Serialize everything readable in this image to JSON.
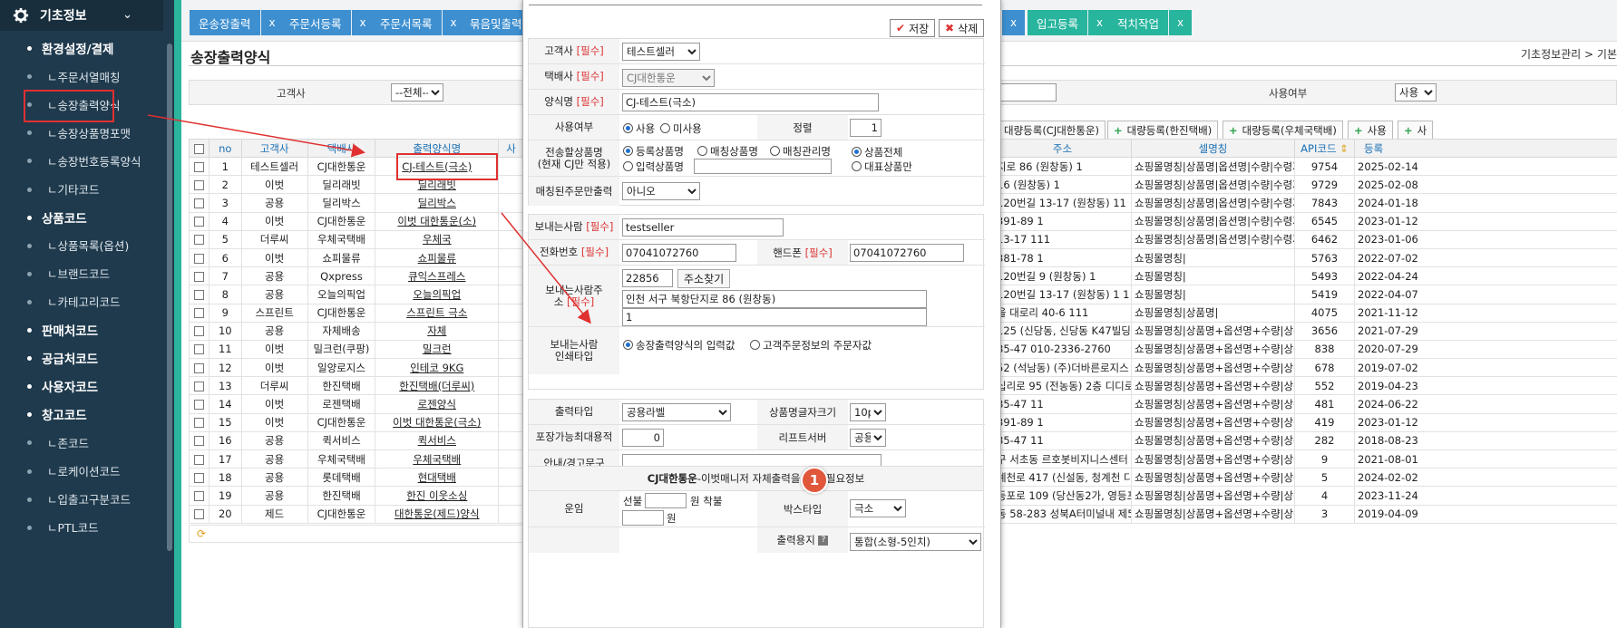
{
  "sidebar": {
    "header": "기초정보",
    "items": [
      {
        "label": "환경설정/결제",
        "kind": "cat"
      },
      {
        "label": "ㄴ주문서열매칭",
        "kind": "sub"
      },
      {
        "label": "ㄴ송장출력양식",
        "kind": "sub"
      },
      {
        "label": "ㄴ송장상품명포맷",
        "kind": "sub"
      },
      {
        "label": "ㄴ송장번호등록양식",
        "kind": "sub"
      },
      {
        "label": "ㄴ기타코드",
        "kind": "sub"
      },
      {
        "label": "상품코드",
        "kind": "cat"
      },
      {
        "label": "ㄴ상품목록(옵션)",
        "kind": "sub"
      },
      {
        "label": "ㄴ브랜드코드",
        "kind": "sub"
      },
      {
        "label": "ㄴ카테고리코드",
        "kind": "sub"
      },
      {
        "label": "판매처코드",
        "kind": "cat"
      },
      {
        "label": "공급처코드",
        "kind": "cat"
      },
      {
        "label": "사용자코드",
        "kind": "cat"
      },
      {
        "label": "창고코드",
        "kind": "cat"
      },
      {
        "label": "ㄴ존코드",
        "kind": "sub"
      },
      {
        "label": "ㄴ로케이션코드",
        "kind": "sub"
      },
      {
        "label": "ㄴ입출고구분코드",
        "kind": "sub"
      },
      {
        "label": "ㄴPTL코드",
        "kind": "sub"
      }
    ]
  },
  "tabs": {
    "t1": "운송장출력",
    "t2": "주문서등록",
    "t3": "주문서목록",
    "t4": "묶음및출력",
    "t5": "입고등록",
    "t6": "적치작업",
    "close": "x"
  },
  "page": {
    "title": "송장출력양식",
    "breadcrumb": "기초정보관리 > 기본",
    "filter": {
      "customer_label": "고객사",
      "customer_value": "--전체--",
      "use_label": "사용여부",
      "use_value": "사용"
    }
  },
  "actions": {
    "b1": "대량등록(CJ대한통운)",
    "b2": "대량등록(한진택배)",
    "b3": "대량등록(우체국택배)",
    "b4": "사용",
    "b5": "사"
  },
  "left_table": {
    "headers": [
      "no",
      "고객사",
      "택배사",
      "출력양식명",
      "사"
    ],
    "rows": [
      [
        "1",
        "테스트셀러",
        "CJ대한통운",
        "CJ-테스트(극소)"
      ],
      [
        "2",
        "이벗",
        "딜리래빗",
        "딜리래빗"
      ],
      [
        "3",
        "공용",
        "딜리박스",
        "딜리박스"
      ],
      [
        "4",
        "이벗",
        "CJ대한통운",
        "이벗 대한통운(소)"
      ],
      [
        "5",
        "더루씨",
        "우체국택배",
        "우체국"
      ],
      [
        "6",
        "이벗",
        "쇼피물류",
        "쇼피물류"
      ],
      [
        "7",
        "공용",
        "Qxpress",
        "큐익스프레스"
      ],
      [
        "8",
        "공용",
        "오늘의픽업",
        "오늘의픽업"
      ],
      [
        "9",
        "스프린트",
        "CJ대한통운",
        "스프린트 극소"
      ],
      [
        "10",
        "공용",
        "자체배송",
        "자체"
      ],
      [
        "11",
        "이벗",
        "밀크런(쿠팡)",
        "밀크런"
      ],
      [
        "12",
        "이벗",
        "일양로지스",
        "인테코 9KG"
      ],
      [
        "13",
        "더루씨",
        "한진택배",
        "한진택배(더루씨)"
      ],
      [
        "14",
        "이벗",
        "로젠택배",
        "로젠양식"
      ],
      [
        "15",
        "이벗",
        "CJ대한통운",
        "이벗 대한통운(극소)"
      ],
      [
        "16",
        "공용",
        "퀵서비스",
        "퀵서비스"
      ],
      [
        "17",
        "공용",
        "우체국택배",
        "우체국택배"
      ],
      [
        "18",
        "공용",
        "롯데택배",
        "현대택배"
      ],
      [
        "19",
        "공용",
        "한진택배",
        "한진 이웃소싱"
      ],
      [
        "20",
        "제드",
        "CJ대한통운",
        "대한통운(제드)양식"
      ]
    ]
  },
  "right_table": {
    "headers": [
      "주소",
      "셀명칭",
      "API코드",
      "등록"
    ],
    "rows": [
      [
        "지로 86 (원창동) 1",
        "쇼핑몰명칭|상품명|옵션명|수량|수령자",
        "9754",
        "2025-02-14"
      ],
      [
        "16 (원창동) 1",
        "쇼핑몰명칭|상품명|옵션명|수량|수령자",
        "9729",
        "2025-02-08"
      ],
      [
        "120번길 13-17 (원창동) 11",
        "쇼핑몰명칭|상품명|옵션명|수량|수령자",
        "7843",
        "2024-01-18"
      ],
      [
        "391-89 1",
        "쇼핑몰명칭|상품명|옵션명|수량|수령자",
        "6545",
        "2023-01-12"
      ],
      [
        "13-17 111",
        "쇼핑몰명칭|상품명|옵션명|수량|수령자",
        "6462",
        "2023-01-06"
      ],
      [
        "381-78 1",
        "쇼핑몰명칭|",
        "5763",
        "2022-07-02"
      ],
      [
        "120번길 9 (원창동) 1",
        "쇼핑몰명칭|",
        "5493",
        "2022-04-24"
      ],
      [
        "120번길 13-17 (원창동) 1 1",
        "쇼핑몰명칭|",
        "5419",
        "2022-04-07"
      ],
      [
        "을 대로리 40-6 111",
        "쇼핑몰명칭|상품명|",
        "4075",
        "2021-11-12"
      ],
      [
        "125 (신당동, 신당동 K47빌딩",
        "쇼핑몰명칭|상품명+옵션명+수량|상품",
        "3656",
        "2021-07-29"
      ],
      [
        "85-47 010-2336-2760",
        "쇼핑몰명칭|상품명+옵션명+수량|상품",
        "838",
        "2020-07-29"
      ],
      [
        "52 (석남동) (주)더바른로지스",
        "쇼핑몰명칭|상품명+옵션명+수량|상품",
        "678",
        "2019-07-02"
      ],
      [
        "십리로 95 (전농동) 2층 디디로",
        "쇼핑몰명칭|상품명+옵션명+수량|상품",
        "552",
        "2019-04-23"
      ],
      [
        "85-47 11",
        "쇼핑몰명칭|상품명+옵션명+수량|상품",
        "481",
        "2024-06-22"
      ],
      [
        "391-89 1",
        "쇼핑몰명칭|상품명+옵션명+수량|상품",
        "419",
        "2023-01-12"
      ],
      [
        "85-47 11",
        "쇼핑몰명칭|상품명+옵션명+수량|상품",
        "282",
        "2018-08-23"
      ],
      [
        "구 서초동 르호봇비지니스센터",
        "쇼핑몰명칭|상품명+옵션명+수량|상품",
        "9",
        "2021-08-01"
      ],
      [
        "계천로 417 (신설동, 청계천 디",
        "쇼핑몰명칭|상품명+옵션명+수량|상품",
        "5",
        "2024-02-02"
      ],
      [
        "등포로 109 (당산동2가, 영등포",
        "쇼핑몰명칭|상품명+옵션명+수량|상품",
        "4",
        "2023-11-24"
      ],
      [
        "동 58-283 성북A터미널내 제5",
        "쇼핑몰명칭|상품명+옵션명+수량|상품",
        "3",
        "2019-04-09"
      ]
    ]
  },
  "modal": {
    "save": "저장",
    "delete": "삭제",
    "customer_label": "고객사",
    "customer_value": "테스트셀러",
    "courier_label": "택배사",
    "courier_value": "CJ대한통운",
    "form_name_label": "양식명",
    "form_name_value": "CJ-테스트(극소)",
    "required": "[필수]",
    "use_label": "사용여부",
    "use_yes": "사용",
    "use_no": "미사용",
    "sort_label": "정렬",
    "sort_value": "1",
    "product_label_1": "전송할상품명",
    "product_label_2": "(현재 CJ만 적용)",
    "opt_reg": "등록상품명",
    "opt_match": "매칭상품명",
    "opt_matchmgr": "매칭관리명",
    "opt_input": "입력상품명",
    "opt_all": "상품전체",
    "opt_rep": "대표상품만",
    "matched_label": "매칭된주문만출력",
    "matched_value": "아니오",
    "sender_label": "보내는사람",
    "sender_value": "testseller",
    "phone_label": "전화번호",
    "phone_value": "07041072760",
    "mobile_label": "핸드폰",
    "mobile_value": "07041072760",
    "zip_value": "22856",
    "zip_btn": "주소찾기",
    "addr_label_1": "보내는사람주",
    "addr_label_2": "소",
    "addr_value": "인천 서구 북항단지로 86 (원창동)",
    "addr_detail": "1",
    "print_type_label_1": "보내는사람",
    "print_type_label_2": "인쇄타입",
    "print_opt1": "송장출력양식의 입력값",
    "print_opt2": "고객주문정보의 주문자값",
    "output_type_label": "출력타입",
    "output_type_value": "공용라벨",
    "font_size_label": "상품명글자크기",
    "font_size_value": "10pt",
    "pack_label": "포장가능최대용적",
    "pack_value": "0",
    "receipt_label": "리프트서버",
    "receipt_value": "공용",
    "notice_label": "안내/경고문구",
    "section_brand": "CJ대한통운",
    "section_text": "-이벗매니저 자체출력을 위한 필요정보",
    "fare_label": "운임",
    "fare_pre": "선불",
    "fare_won1": "원 착불",
    "fare_won2": "원",
    "box_label": "박스타입",
    "box_value": "극소",
    "paper_label": "출력용지",
    "paper_value": "통합(소형-5인치)"
  },
  "badge": "1",
  "colors": {
    "sidebar": "#1f3a4d",
    "accent": "#2bb59c",
    "tab_blue": "#3d8fd0",
    "tab_green": "#27b59d",
    "annotation": "#e03030"
  }
}
